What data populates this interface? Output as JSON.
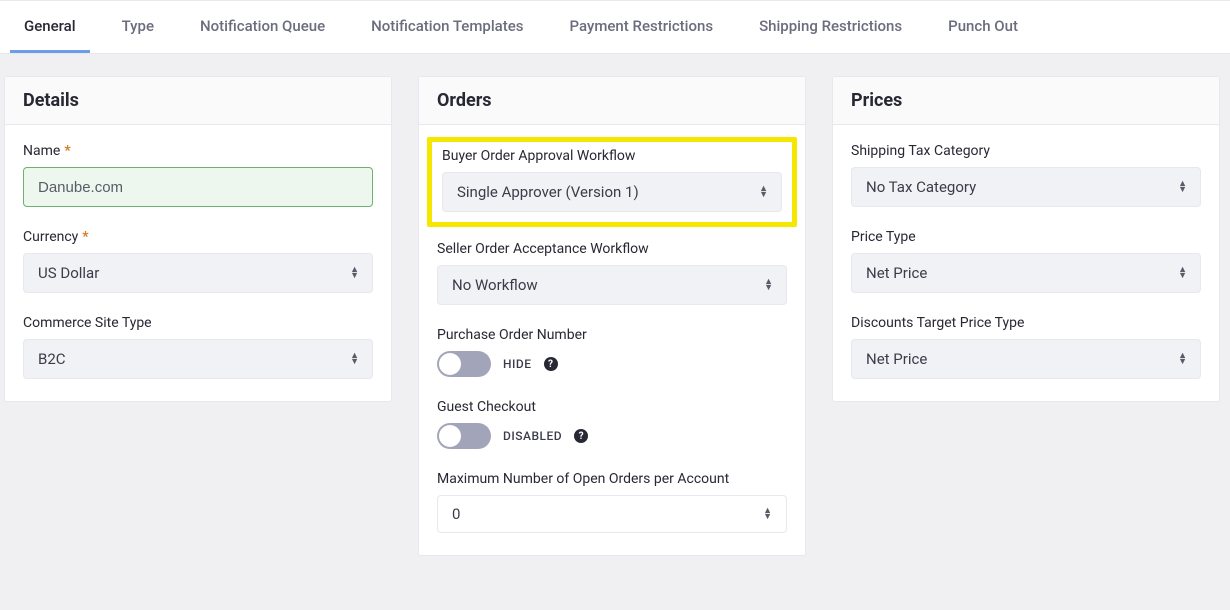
{
  "tabs": {
    "general": "General",
    "type": "Type",
    "notification_queue": "Notification Queue",
    "notification_templates": "Notification Templates",
    "payment_restrictions": "Payment Restrictions",
    "shipping_restrictions": "Shipping Restrictions",
    "punch_out": "Punch Out"
  },
  "details": {
    "title": "Details",
    "name_label": "Name",
    "name_value": "Danube.com",
    "currency_label": "Currency",
    "currency_value": "US Dollar",
    "site_type_label": "Commerce Site Type",
    "site_type_value": "B2C"
  },
  "orders": {
    "title": "Orders",
    "buyer_workflow_label": "Buyer Order Approval Workflow",
    "buyer_workflow_value": "Single Approver (Version 1)",
    "seller_workflow_label": "Seller Order Acceptance Workflow",
    "seller_workflow_value": "No Workflow",
    "po_number_label": "Purchase Order Number",
    "po_number_state": "HIDE",
    "guest_checkout_label": "Guest Checkout",
    "guest_checkout_state": "DISABLED",
    "max_open_orders_label": "Maximum Number of Open Orders per Account",
    "max_open_orders_value": "0"
  },
  "prices": {
    "title": "Prices",
    "shipping_tax_label": "Shipping Tax Category",
    "shipping_tax_value": "No Tax Category",
    "price_type_label": "Price Type",
    "price_type_value": "Net Price",
    "discounts_target_label": "Discounts Target Price Type",
    "discounts_target_value": "Net Price"
  },
  "ui": {
    "required_star": "*",
    "help_glyph": "?"
  }
}
